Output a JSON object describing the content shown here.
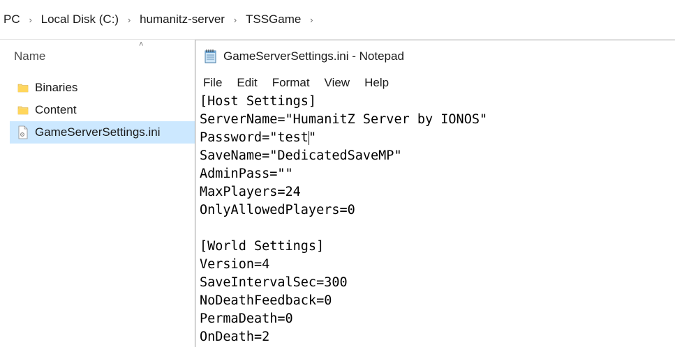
{
  "breadcrumb": {
    "items": [
      "PC",
      "Local Disk (C:)",
      "humanitz-server",
      "TSSGame"
    ],
    "separator": "›"
  },
  "explorer": {
    "column_name": "Name",
    "files": [
      {
        "name": "Binaries",
        "icon": "folder-icon"
      },
      {
        "name": "Content",
        "icon": "folder-icon"
      },
      {
        "name": "GameServerSettings.ini",
        "icon": "ini-file-icon",
        "selected": true
      }
    ]
  },
  "notepad": {
    "title": "GameServerSettings.ini - Notepad",
    "menu": [
      "File",
      "Edit",
      "Format",
      "View",
      "Help"
    ],
    "lines": [
      "[Host Settings]",
      "ServerName=\"HumanitZ Server by IONOS\"",
      "Password=\"test\"",
      "SaveName=\"DedicatedSaveMP\"",
      "AdminPass=\"\"",
      "MaxPlayers=24",
      "OnlyAllowedPlayers=0",
      "",
      "[World Settings]",
      "Version=4",
      "SaveIntervalSec=300",
      "NoDeathFeedback=0",
      "PermaDeath=0",
      "OnDeath=2"
    ]
  },
  "colors": {
    "selection": "#cce8ff",
    "folder": "#f8d775",
    "text": "#1a1a1a"
  }
}
